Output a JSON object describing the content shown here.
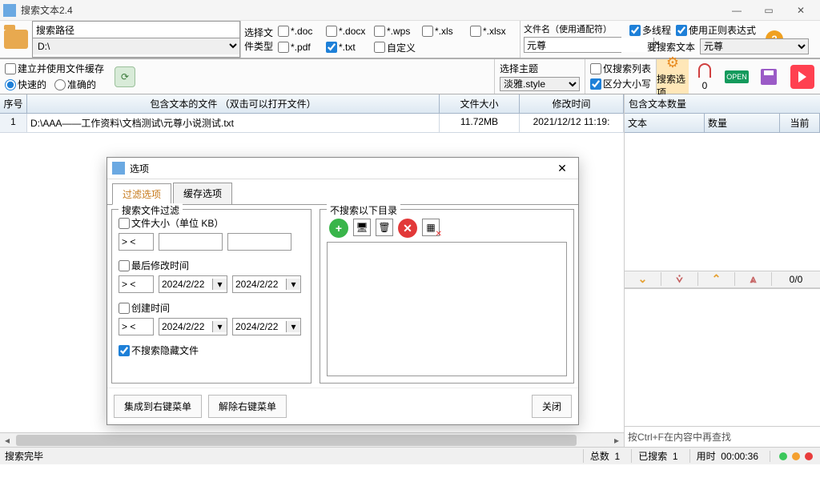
{
  "window": {
    "title": "搜索文本2.4"
  },
  "toolbar": {
    "path_label": "搜索路径",
    "drive": "D:\\",
    "types_label_a": "选择文",
    "types_label_b": "件类型",
    "ext": {
      "doc": "*.doc",
      "docx": "*.docx",
      "wps": "*.wps",
      "xls": "*.xls",
      "xlsx": "*.xlsx",
      "pdf": "*.pdf",
      "txt": "*.txt",
      "custom": "自定义"
    },
    "filename_label": "文件名（使用通配符）",
    "filename_value": "元尊",
    "multithread": "多线程",
    "regex": "使用正则表达式",
    "search_text_label": "要搜索文本",
    "search_text_value": "元尊"
  },
  "toolbar2": {
    "cache": "建立并使用文件缓存",
    "fast": "快速的",
    "accurate": "准确的",
    "theme_label": "选择主题",
    "theme_value": "淡雅.style",
    "only_list": "仅搜索列表",
    "case": "区分大小写",
    "opts": "搜索选项",
    "zero": "0",
    "open": "OPEN"
  },
  "grid": {
    "h_num": "序号",
    "h_file": "包含文本的文件 （双击可以打开文件）",
    "h_size": "文件大小",
    "h_time": "修改时间",
    "row": {
      "num": "1",
      "file": "D:\\AAA——工作资料\\文档测试\\元尊小说测试.txt",
      "size": "11.72MB",
      "time": "2021/12/12 11:19:"
    }
  },
  "right": {
    "title": "包含文本数量",
    "c_text": "文本",
    "c_count": "数量",
    "c_cur": "当前",
    "counter": "0/0",
    "hint": "按Ctrl+F在内容中再查找"
  },
  "dialog": {
    "title": "选项",
    "tab_filter": "过滤选项",
    "tab_cache": "缓存选项",
    "legend_filter": "搜索文件过滤",
    "legend_dirs": "不搜索以下目录",
    "size_label": "文件大小（单位 KB）",
    "op": "> <",
    "mtime_label": "最后修改时间",
    "ctime_label": "创建时间",
    "date": "2024/2/22",
    "hidden": "不搜索隐藏文件",
    "btn_add_menu": "集成到右键菜单",
    "btn_rm_menu": "解除右键菜单",
    "btn_close": "关闭"
  },
  "status": {
    "done": "搜索完毕",
    "total": "总数",
    "total_v": "1",
    "searched": "已搜索",
    "searched_v": "1",
    "elapsed": "用时",
    "elapsed_v": "00:00:36"
  }
}
